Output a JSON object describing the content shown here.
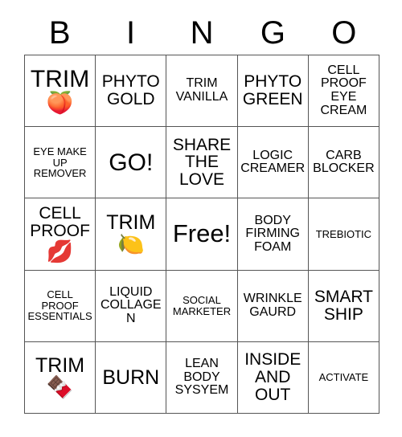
{
  "card": {
    "header_letters": [
      "B",
      "I",
      "N",
      "G",
      "O"
    ],
    "free_space_label": "Free!",
    "colors": {
      "background": "#ffffff",
      "text": "#000000",
      "grid_line": "#555555"
    },
    "rows": [
      [
        {
          "text": "TRIM",
          "emoji": "🍑",
          "emoji_name": "peach-emoji",
          "size": "xl"
        },
        {
          "text": "PHYTO\nGOLD",
          "emoji": "",
          "emoji_name": "",
          "size": "md"
        },
        {
          "text": "TRIM\nVANILLA",
          "emoji": "",
          "emoji_name": "",
          "size": "sm"
        },
        {
          "text": "PHYTO\nGREEN",
          "emoji": "",
          "emoji_name": "",
          "size": "md"
        },
        {
          "text": "CELL\nPROOF\nEYE\nCREAM",
          "emoji": "",
          "emoji_name": "",
          "size": "sm"
        }
      ],
      [
        {
          "text": "EYE MAKE\nUP\nREMOVER",
          "emoji": "",
          "emoji_name": "",
          "size": "xs"
        },
        {
          "text": "GO!",
          "emoji": "",
          "emoji_name": "",
          "size": "xl"
        },
        {
          "text": "SHARE\nTHE\nLOVE",
          "emoji": "",
          "emoji_name": "",
          "size": "md"
        },
        {
          "text": "LOGIC\nCREAMER",
          "emoji": "",
          "emoji_name": "",
          "size": "sm"
        },
        {
          "text": "CARB\nBLOCKER",
          "emoji": "",
          "emoji_name": "",
          "size": "sm"
        }
      ],
      [
        {
          "text": "CELL\nPROOF",
          "emoji": "💋",
          "emoji_name": "kiss-lips-emoji",
          "size": "md"
        },
        {
          "text": "TRIM",
          "emoji": "🍋",
          "emoji_name": "lemon-emoji",
          "size": "lg"
        },
        {
          "text": "Free!",
          "emoji": "",
          "emoji_name": "",
          "size": "free"
        },
        {
          "text": "BODY\nFIRMING\nFOAM",
          "emoji": "",
          "emoji_name": "",
          "size": "sm"
        },
        {
          "text": "TREBIOTIC",
          "emoji": "",
          "emoji_name": "",
          "size": "xs"
        }
      ],
      [
        {
          "text": "CELL\nPROOF\nESSENTIALS",
          "emoji": "",
          "emoji_name": "",
          "size": "xs"
        },
        {
          "text": "LIQUID\nCOLLAGEN",
          "emoji": "",
          "emoji_name": "",
          "size": "sm"
        },
        {
          "text": "SOCIAL\nMARKETER",
          "emoji": "",
          "emoji_name": "",
          "size": "xs"
        },
        {
          "text": "WRINKLE\nGAURD",
          "emoji": "",
          "emoji_name": "",
          "size": "sm"
        },
        {
          "text": "SMART\nSHIP",
          "emoji": "",
          "emoji_name": "",
          "size": "md"
        }
      ],
      [
        {
          "text": "TRIM",
          "emoji": "🍫",
          "emoji_name": "chocolate-bar-emoji",
          "size": "lg"
        },
        {
          "text": "BURN",
          "emoji": "",
          "emoji_name": "",
          "size": "lg"
        },
        {
          "text": "LEAN\nBODY\nSYSYEM",
          "emoji": "",
          "emoji_name": "",
          "size": "sm"
        },
        {
          "text": "INSIDE\nAND\nOUT",
          "emoji": "",
          "emoji_name": "",
          "size": "md"
        },
        {
          "text": "ACTIVATE",
          "emoji": "",
          "emoji_name": "",
          "size": "xs"
        }
      ]
    ]
  }
}
